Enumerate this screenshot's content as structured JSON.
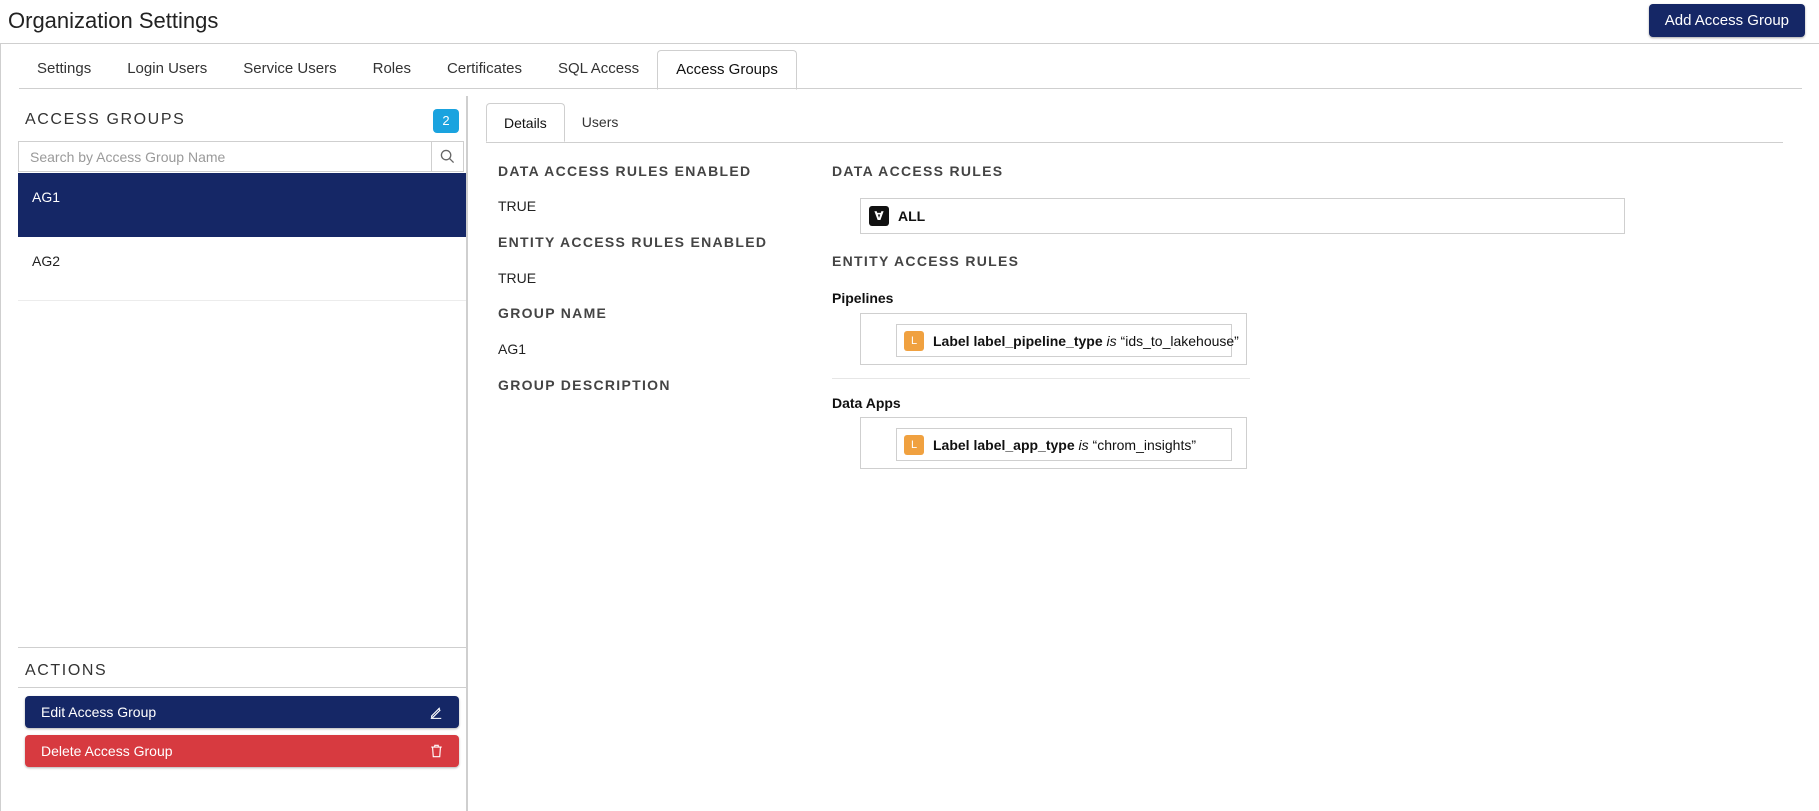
{
  "header": {
    "title": "Organization Settings",
    "add_button_label": "Add Access Group"
  },
  "tabs": [
    {
      "label": "Settings",
      "active": false
    },
    {
      "label": "Login Users",
      "active": false
    },
    {
      "label": "Service Users",
      "active": false
    },
    {
      "label": "Roles",
      "active": false
    },
    {
      "label": "Certificates",
      "active": false
    },
    {
      "label": "SQL Access",
      "active": false
    },
    {
      "label": "Access Groups",
      "active": true
    }
  ],
  "access_groups": {
    "title": "ACCESS GROUPS",
    "count": "2",
    "search_placeholder": "Search by Access Group Name",
    "items": [
      {
        "name": "AG1",
        "selected": true
      },
      {
        "name": "AG2",
        "selected": false
      }
    ]
  },
  "actions": {
    "title": "ACTIONS",
    "edit_label": "Edit Access Group",
    "delete_label": "Delete Access Group"
  },
  "detail_tabs": [
    {
      "label": "Details",
      "active": true
    },
    {
      "label": "Users",
      "active": false
    }
  ],
  "details": {
    "data_access_enabled_label": "DATA ACCESS RULES ENABLED",
    "data_access_enabled_value": "TRUE",
    "entity_access_enabled_label": "ENTITY ACCESS RULES ENABLED",
    "entity_access_enabled_value": "TRUE",
    "group_name_label": "GROUP NAME",
    "group_name_value": "AG1",
    "group_description_label": "GROUP DESCRIPTION",
    "group_description_value": ""
  },
  "data_access_rules": {
    "title": "DATA ACCESS RULES",
    "chip": "∀",
    "value": "ALL"
  },
  "entity_access_rules": {
    "title": "ENTITY ACCESS RULES",
    "groups": [
      {
        "name": "Pipelines",
        "chip": "L",
        "kind": "Label",
        "key": "label_pipeline_type",
        "op": "is",
        "value": "“ids_to_lakehouse”"
      },
      {
        "name": "Data Apps",
        "chip": "L",
        "kind": "Label",
        "key": "label_app_type",
        "op": "is",
        "value": "“chrom_insights”"
      }
    ]
  },
  "colors": {
    "primary": "#152766",
    "danger": "#d73a40",
    "badge": "#1aa3df",
    "label_chip": "#f0a140"
  },
  "icons": {
    "search": "search-icon",
    "edit": "pencil-icon",
    "delete": "trash-icon"
  }
}
